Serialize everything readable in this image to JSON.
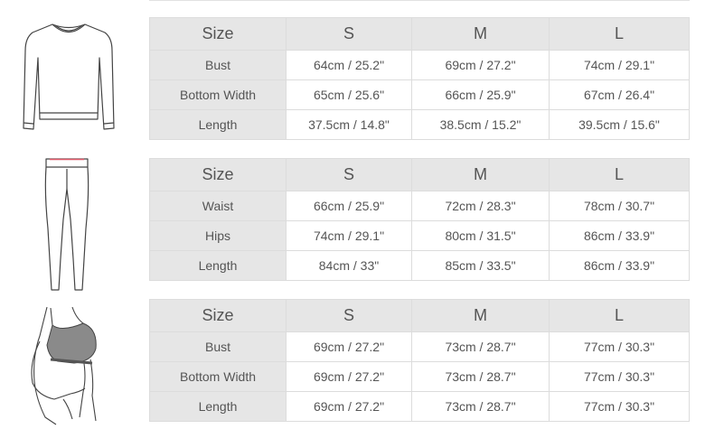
{
  "tables": [
    {
      "header": [
        "Size",
        "S",
        "M",
        "L"
      ],
      "rows": [
        [
          "Bust",
          "64cm / 25.2\"",
          "69cm / 27.2\"",
          "74cm / 29.1\""
        ],
        [
          "Bottom Width",
          "65cm / 25.6\"",
          "66cm / 25.9\"",
          "67cm / 26.4\""
        ],
        [
          "Length",
          "37.5cm / 14.8\"",
          "38.5cm / 15.2\"",
          "39.5cm / 15.6\""
        ]
      ]
    },
    {
      "header": [
        "Size",
        "S",
        "M",
        "L"
      ],
      "rows": [
        [
          "Waist",
          "66cm / 25.9\"",
          "72cm / 28.3\"",
          "78cm / 30.7\""
        ],
        [
          "Hips",
          "74cm / 29.1\"",
          "80cm / 31.5\"",
          "86cm / 33.9\""
        ],
        [
          "Length",
          "84cm / 33\"",
          "85cm / 33.5\"",
          "86cm / 33.9\""
        ]
      ]
    },
    {
      "header": [
        "Size",
        "S",
        "M",
        "L"
      ],
      "rows": [
        [
          "Bust",
          "69cm / 27.2\"",
          "73cm / 28.7\"",
          "77cm / 30.3\""
        ],
        [
          "Bottom Width",
          "69cm / 27.2\"",
          "73cm / 28.7\"",
          "77cm / 30.3\""
        ],
        [
          "Length",
          "69cm / 27.2\"",
          "73cm / 28.7\"",
          "77cm / 30.3\""
        ]
      ]
    }
  ],
  "illustrations": [
    "sweatshirt-icon",
    "leggings-icon",
    "sports-bra-figure-icon"
  ],
  "colors": {
    "header_bg": "#e6e6e6",
    "border": "#dcdcdc",
    "text": "#555555",
    "waistband_accent": "#e05a6a"
  }
}
